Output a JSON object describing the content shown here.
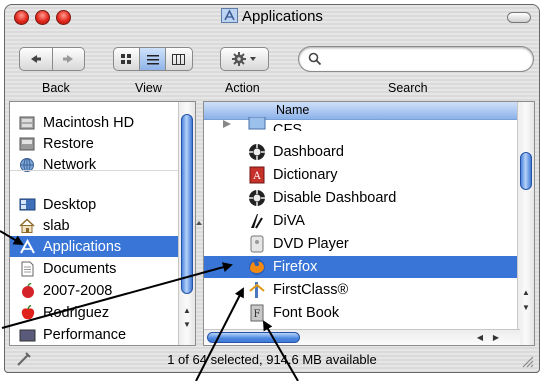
{
  "window": {
    "title": "Applications"
  },
  "toolbar": {
    "back_label": "Back",
    "view_label": "View",
    "action_label": "Action",
    "search_label": "Search",
    "search_placeholder": "",
    "accent": "#3875d7"
  },
  "sidebar": {
    "devices": [
      {
        "label": "Macintosh HD",
        "icon": "hard-drive-icon"
      },
      {
        "label": "Restore",
        "icon": "disk-icon"
      },
      {
        "label": "Network",
        "icon": "globe-icon"
      }
    ],
    "places": [
      {
        "label": "Desktop",
        "icon": "desktop-icon"
      },
      {
        "label": "slab",
        "icon": "home-icon"
      },
      {
        "label": "Applications",
        "icon": "applications-icon",
        "selected": true
      },
      {
        "label": "Documents",
        "icon": "document-icon"
      },
      {
        "label": "2007-2008",
        "icon": "folder-apple-icon"
      },
      {
        "label": "Rodriguez",
        "icon": "apple-icon"
      },
      {
        "label": "Performance",
        "icon": "folder-icon"
      }
    ]
  },
  "list": {
    "column_header": "Name",
    "partial_top_label": "CFS",
    "rows": [
      {
        "label": "Dashboard",
        "icon": "dashboard-icon"
      },
      {
        "label": "Dictionary",
        "icon": "dictionary-icon"
      },
      {
        "label": "Disable Dashboard",
        "icon": "dashboard-icon"
      },
      {
        "label": "DiVA",
        "icon": "diva-icon"
      },
      {
        "label": "DVD Player",
        "icon": "dvd-player-icon"
      },
      {
        "label": "Firefox",
        "icon": "firefox-icon",
        "selected": true
      },
      {
        "label": "FirstClass®",
        "icon": "firstclass-icon"
      },
      {
        "label": "Font Book",
        "icon": "font-book-icon"
      }
    ]
  },
  "status": {
    "text": "1 of 64 selected, 914.6 MB available"
  }
}
